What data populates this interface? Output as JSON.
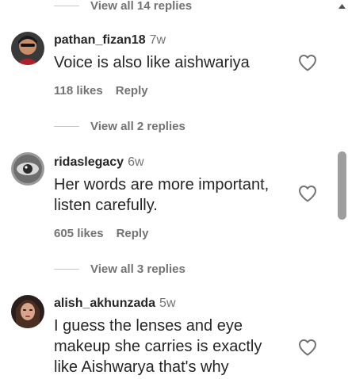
{
  "threads": [
    {
      "view_replies": "View all 14 replies"
    },
    {
      "username": "pathan_fizan18",
      "time": "7w",
      "text_lines": [
        "Voice is also like aishwariya"
      ],
      "likes": "118 likes",
      "reply": "Reply",
      "view_replies": "View all 2 replies"
    },
    {
      "username": "ridaslegacy",
      "time": "6w",
      "text_lines": [
        "Her words are more important,",
        "listen carefully."
      ],
      "likes": "605 likes",
      "reply": "Reply",
      "view_replies": "View all 3 replies"
    },
    {
      "username": "alish_akhunzada",
      "time": "5w",
      "text_lines": [
        "I guess the lenses and eye",
        "makeup she carries is exactly",
        "like Aishwarya that's why"
      ]
    }
  ],
  "icons": {
    "like": "heart-outline-icon",
    "scroll_up": "triangle-up-icon"
  }
}
